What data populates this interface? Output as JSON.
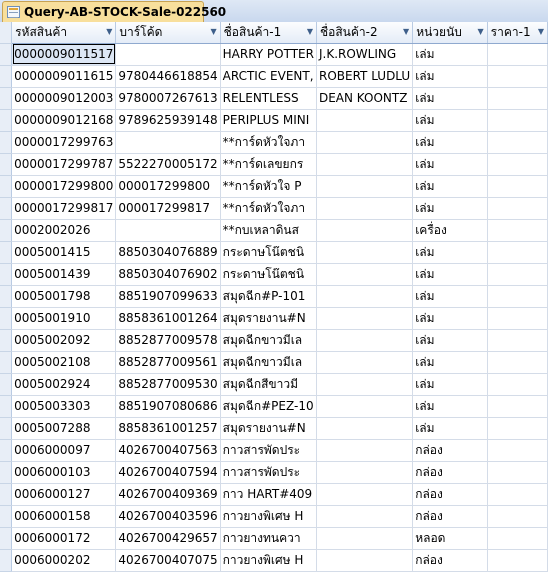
{
  "tab": {
    "title": "Query-AB-STOCK-Sale-022560"
  },
  "columns": [
    {
      "label": "รหัสสินค้า"
    },
    {
      "label": "บาร์โค้ด"
    },
    {
      "label": "ชื่อสินค้า-1"
    },
    {
      "label": "ชื่อสินค้า-2"
    },
    {
      "label": "หน่วยนับ"
    },
    {
      "label": "ราคา-1"
    }
  ],
  "rows": [
    [
      "0000009011517",
      "",
      "HARRY POTTER",
      "J.K.ROWLING",
      "เล่ม",
      ""
    ],
    [
      "0000009011615",
      "9780446618854",
      "ARCTIC EVENT,",
      "ROBERT LUDLU",
      "เล่ม",
      ""
    ],
    [
      "0000009012003",
      "9780007267613",
      "RELENTLESS",
      "DEAN KOONTZ",
      "เล่ม",
      ""
    ],
    [
      "0000009012168",
      "9789625939148",
      "PERIPLUS MINI",
      "",
      "เล่ม",
      ""
    ],
    [
      "0000017299763",
      "",
      "**การ์ดหัวใจภา",
      "",
      "เล่ม",
      ""
    ],
    [
      "0000017299787",
      "5522270005172",
      "**การ์ดเลขยกร",
      "",
      "เล่ม",
      ""
    ],
    [
      "0000017299800",
      "000017299800",
      "**การ์ดหัวใจ P",
      "",
      "เล่ม",
      ""
    ],
    [
      "0000017299817",
      "000017299817",
      "**การ์ดหัวใจภา",
      "",
      "เล่ม",
      ""
    ],
    [
      "0002002026",
      "",
      "**กบเหลาดินส",
      "",
      "เครื่อง",
      ""
    ],
    [
      "0005001415",
      "8850304076889",
      "กระดาษโน๊ตชนิ",
      "",
      "เล่ม",
      ""
    ],
    [
      "0005001439",
      "8850304076902",
      "กระดาษโน๊ตชนิ",
      "",
      "เล่ม",
      ""
    ],
    [
      "0005001798",
      "8851907099633",
      "สมุดฉีก#P-101",
      "",
      "เล่ม",
      ""
    ],
    [
      "0005001910",
      "8858361001264",
      "สมุดรายงาน#N",
      "",
      "เล่ม",
      ""
    ],
    [
      "0005002092",
      "8852877009578",
      "สมุดฉีกขาวมีเล",
      "",
      "เล่ม",
      ""
    ],
    [
      "0005002108",
      "8852877009561",
      "สมุดฉีกขาวมีเล",
      "",
      "เล่ม",
      ""
    ],
    [
      "0005002924",
      "8852877009530",
      "สมุดฉีกสีขาวมี",
      "",
      "เล่ม",
      ""
    ],
    [
      "0005003303",
      "8851907080686",
      "สมุดฉีก#PEZ-10",
      "",
      "เล่ม",
      ""
    ],
    [
      "0005007288",
      "8858361001257",
      "สมุดรายงาน#N",
      "",
      "เล่ม",
      ""
    ],
    [
      "0006000097",
      "4026700407563",
      "กาวสารพัดประ",
      "",
      "กล่อง",
      ""
    ],
    [
      "0006000103",
      "4026700407594",
      "กาวสารพัดประ",
      "",
      "กล่อง",
      ""
    ],
    [
      "0006000127",
      "4026700409369",
      "กาว HART#409",
      "",
      "กล่อง",
      ""
    ],
    [
      "0006000158",
      "4026700403596",
      "กาวยางพิเศษ H",
      "",
      "กล่อง",
      ""
    ],
    [
      "0006000172",
      "4026700429657",
      "กาวยางทนควา",
      "",
      "หลอด",
      ""
    ],
    [
      "0006000202",
      "4026700407075",
      "กาวยางพิเศษ H",
      "",
      "กล่อง",
      ""
    ]
  ],
  "icons": {
    "tab": "query-table-icon",
    "column_dropdown": "chevron-down-icon"
  },
  "colors": {
    "tab_bg": "#f8df9c",
    "header_bg": "#e4ecf7",
    "selector_bg": "#e8eef7"
  }
}
